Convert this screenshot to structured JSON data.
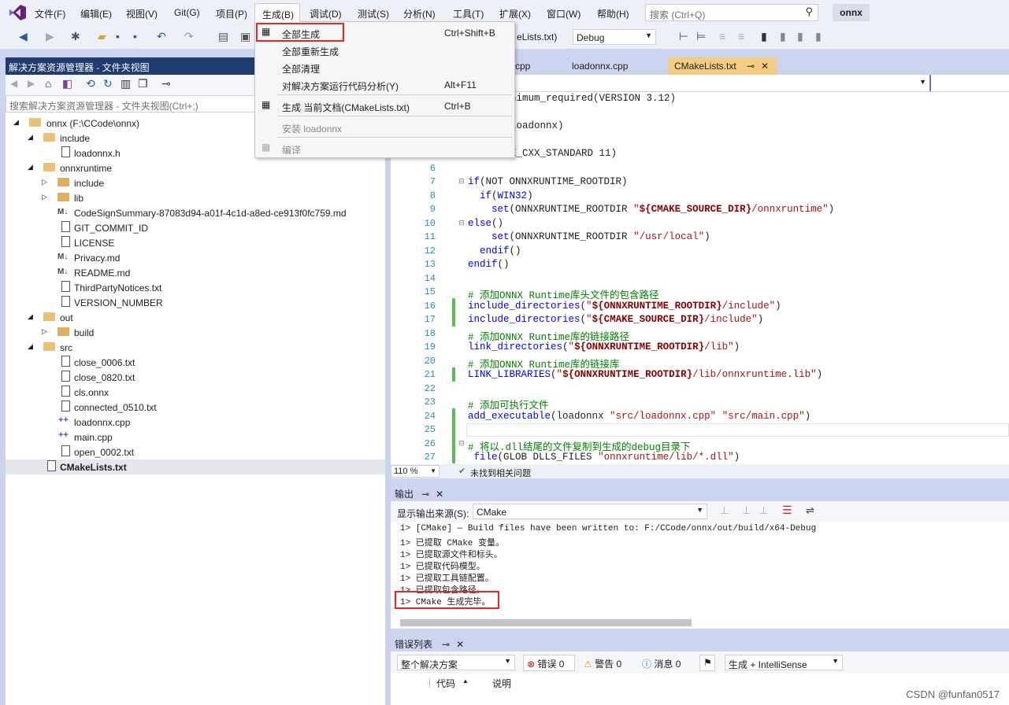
{
  "menubar": {
    "items": [
      "文件(F)",
      "编辑(E)",
      "视图(V)",
      "Git(G)",
      "项目(P)",
      "生成(B)",
      "调试(D)",
      "测试(S)",
      "分析(N)",
      "工具(T)",
      "扩展(X)",
      "窗口(W)",
      "帮助(H)"
    ],
    "search_placeholder": "搜索 (Ctrl+Q)",
    "project": "onnx"
  },
  "toolbar": {
    "startup_item": "eLists.txt)",
    "config": "Debug"
  },
  "build_menu": {
    "items": [
      {
        "label": "全部生成",
        "shortcut": "Ctrl+Shift+B"
      },
      {
        "label": "全部重新生成",
        "shortcut": ""
      },
      {
        "label": "全部清理",
        "shortcut": ""
      },
      {
        "label": "对解决方案运行代码分析(Y)",
        "shortcut": "Alt+F11"
      },
      {
        "label": "生成 当前文档(CMakeLists.txt)",
        "shortcut": "Ctrl+B"
      },
      {
        "label": "安装 loadonnx",
        "shortcut": ""
      },
      {
        "label": "编译",
        "shortcut": ""
      }
    ]
  },
  "solution_explorer": {
    "title": "解决方案资源管理器 - 文件夹视图",
    "search_placeholder": "搜索解决方案资源管理器 - 文件夹视图(Ctrl+;)",
    "tree": [
      "onnx (F:\\CCode\\onnx)",
      "include",
      "loadonnx.h",
      "onnxruntime",
      "include",
      "lib",
      "CodeSignSummary-87083d94-a01f-4c1d-a8ed-ce913f0fc759.md",
      "GIT_COMMIT_ID",
      "LICENSE",
      "Privacy.md",
      "README.md",
      "ThirdPartyNotices.txt",
      "VERSION_NUMBER",
      "out",
      "build",
      "src",
      "close_0006.txt",
      "close_0820.txt",
      "cls.onnx",
      "connected_0510.txt",
      "loadonnx.cpp",
      "main.cpp",
      "open_0002.txt",
      "CMakeLists.txt"
    ]
  },
  "editor": {
    "tabs": [
      "cpp",
      "loadonnx.cpp",
      "CMakeLists.txt"
    ],
    "pin": "⊸",
    "close": "✕",
    "zoom": "110 %",
    "status": "未找到相关问题",
    "line_numbers": [
      "6",
      "7",
      "8",
      "9",
      "10",
      "11",
      "12",
      "13",
      "14",
      "15",
      "16",
      "17",
      "18",
      "19",
      "20",
      "21",
      "22",
      "23",
      "24",
      "25",
      "26",
      "27"
    ],
    "visible_fragments": [
      "nimum_required(VERSION 3.12)",
      "loadonnx)",
      "E_CXX_STANDARD 11)"
    ]
  },
  "output": {
    "title": "输出",
    "source_label": "显示输出来源(S):",
    "source": "CMake",
    "lines": [
      "1> [CMake] — Build files have been written to: F:/CCode/onnx/out/build/x64-Debug",
      "1> 已提取 CMake 变量。",
      "1> 已提取源文件和标头。",
      "1> 已提取代码模型。",
      "1> 已提取工具链配置。",
      "1> 已提取包含路径。",
      "1> CMake 生成完毕。"
    ]
  },
  "errors": {
    "title": "错误列表",
    "scope": "整个解决方案",
    "errors": "错误 0",
    "warnings": "警告 0",
    "messages": "消息 0",
    "filter": "生成 + IntelliSense",
    "col_code": "代码",
    "col_desc": "说明"
  },
  "watermark": "CSDN @funfan0517"
}
